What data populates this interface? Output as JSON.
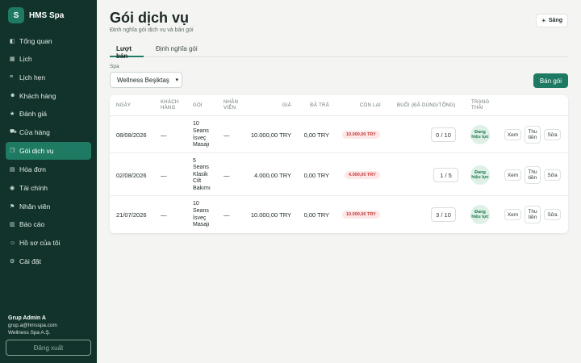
{
  "brand": {
    "logo": "S",
    "name": "HMS Spa"
  },
  "sidebar": {
    "items": [
      {
        "icon": "◧",
        "label": "Tổng quan"
      },
      {
        "icon": "▦",
        "label": "Lịch"
      },
      {
        "icon": "≡",
        "label": "Lịch hẹn"
      },
      {
        "icon": "☻",
        "label": "Khách hàng"
      },
      {
        "icon": "★",
        "label": "Đánh giá"
      },
      {
        "icon": "⛟",
        "label": "Cửa hàng"
      },
      {
        "icon": "❒",
        "label": "Gói dịch vụ"
      },
      {
        "icon": "▤",
        "label": "Hóa đơn"
      },
      {
        "icon": "◉",
        "label": "Tài chính"
      },
      {
        "icon": "⚑",
        "label": "Nhân viên"
      },
      {
        "icon": "▥",
        "label": "Báo cáo"
      },
      {
        "icon": "☺",
        "label": "Hồ sơ của tôi"
      },
      {
        "icon": "⚙",
        "label": "Cài đặt"
      }
    ],
    "active_index": 6
  },
  "user": {
    "name": "Grup Admin A",
    "email": "grup.a@hmsspa.com",
    "company": "Wellness Spa A.Ş."
  },
  "logout_label": "Đăng xuất",
  "header": {
    "title": "Gói dịch vụ",
    "subtitle": "Định nghĩa gói dịch vụ và bán gói",
    "theme_icon": "☀",
    "theme_label": "Sáng"
  },
  "tabs": [
    {
      "label": "Lượt bán"
    },
    {
      "label": "Định nghĩa gói"
    }
  ],
  "filter": {
    "label": "Spa",
    "value": "Wellness Beşiktaş"
  },
  "sell_button": "Bán gói",
  "table": {
    "columns": [
      "Ngày",
      "Khách hàng",
      "Gói",
      "Nhân viên",
      "Giá",
      "Đã trả",
      "Còn lại",
      "Buổi (đã dùng/tổng)",
      "Trạng thái"
    ],
    "rows": [
      {
        "date": "08/08/2026",
        "customer": "—",
        "package": "10 Seans İsveç Masajı",
        "staff": "—",
        "price": "10.000,00 TRY",
        "paid": "0,00 TRY",
        "remaining": "10.000,00 TRY",
        "sessions": "0 / 10",
        "status": "Đang hiệu lực"
      },
      {
        "date": "02/08/2026",
        "customer": "—",
        "package": "5 Seans Klasik Cilt Bakımı",
        "staff": "—",
        "price": "4.000,00 TRY",
        "paid": "0,00 TRY",
        "remaining": "4.000,00 TRY",
        "sessions": "1 / 5",
        "status": "Đang hiệu lực"
      },
      {
        "date": "21/07/2026",
        "customer": "—",
        "package": "10 Seans İsveç Masajı",
        "staff": "—",
        "price": "10.000,00 TRY",
        "paid": "0,00 TRY",
        "remaining": "10.000,00 TRY",
        "sessions": "3 / 10",
        "status": "Đang hiệu lực"
      }
    ],
    "actions": {
      "view": "Xem",
      "collect": "Thu tiền",
      "edit": "Sửa"
    }
  },
  "colors": {
    "sidebar_bg": "#12332b",
    "accent": "#1f7a63",
    "due_red": "#c53939",
    "status_green": "#1e7a4e"
  }
}
